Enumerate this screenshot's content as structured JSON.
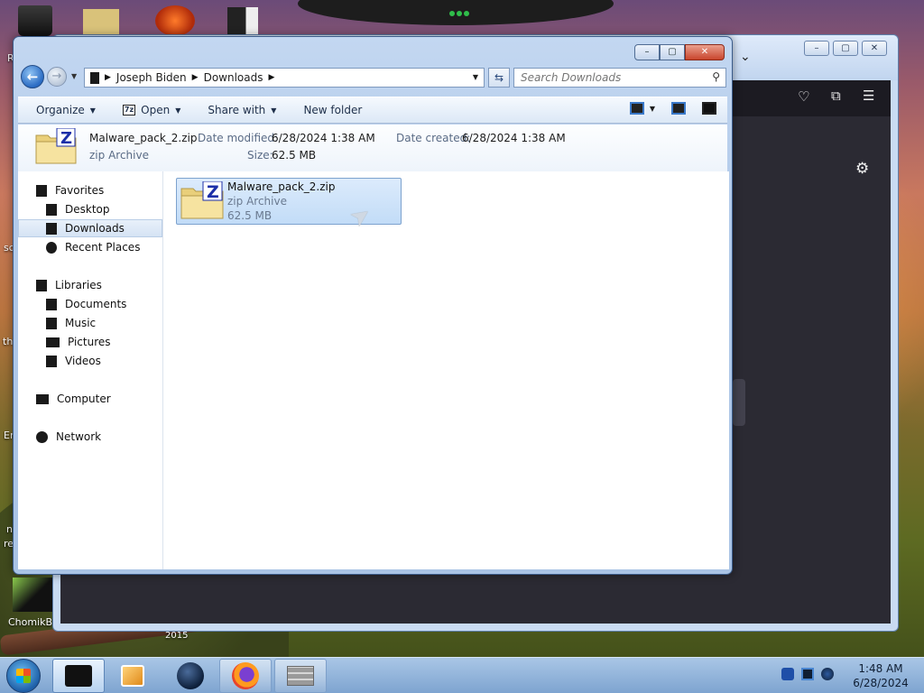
{
  "desktop": {
    "icons": [
      {
        "label": "ChomikB"
      },
      {
        "label": "2015"
      }
    ],
    "edge_fragments": [
      "R",
      "sc",
      "th",
      "Er",
      "n",
      "re"
    ]
  },
  "explorer": {
    "breadcrumb": [
      "Joseph Biden",
      "Downloads"
    ],
    "search_placeholder": "Search Downloads",
    "toolbar": {
      "organize": "Organize",
      "open": "Open",
      "open_icon_text": "7z",
      "share_with": "Share with",
      "new_folder": "New folder"
    },
    "details": {
      "name": "Malware_pack_2.zip",
      "type": "zip Archive",
      "date_modified_label": "Date modified:",
      "date_modified": "6/28/2024 1:38 AM",
      "size_label": "Size:",
      "size": "62.5 MB",
      "date_created_label": "Date created:",
      "date_created": "6/28/2024 1:38 AM"
    },
    "sidebar": {
      "favorites": "Favorites",
      "desktop": "Desktop",
      "downloads": "Downloads",
      "recent_places": "Recent Places",
      "libraries": "Libraries",
      "documents": "Documents",
      "music": "Music",
      "pictures": "Pictures",
      "videos": "Videos",
      "computer": "Computer",
      "network": "Network"
    },
    "files": [
      {
        "name": "Malware_pack_2.zip",
        "type": "zip Archive",
        "size": "62.5 MB"
      }
    ]
  },
  "taskbar": {
    "time": "1:48 AM",
    "date": "6/28/2024"
  },
  "colors": {
    "selection": "#c2dcf7",
    "window_frame": "#b3cbea",
    "firefox_dark": "#2b2a33"
  }
}
